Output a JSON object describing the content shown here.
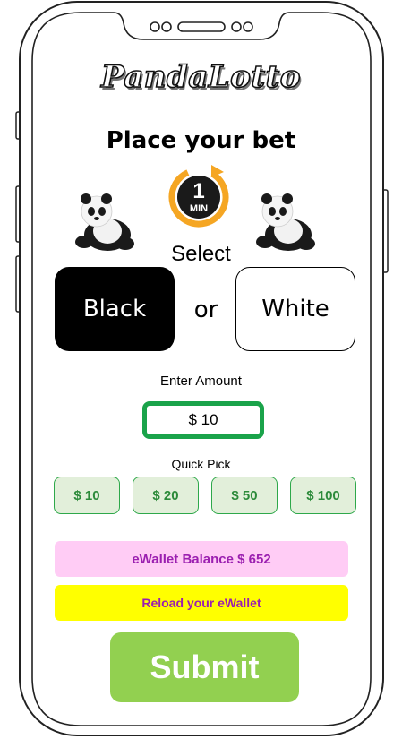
{
  "app": {
    "logo_text": "PandaLotto",
    "headline": "Place your bet"
  },
  "timer": {
    "value": "1",
    "unit": "MIN"
  },
  "bet": {
    "select_label": "Select",
    "black_label": "Black",
    "or_label": "or",
    "white_label": "White"
  },
  "amount": {
    "label": "Enter Amount",
    "value": "$ 10"
  },
  "quick_pick": {
    "label": "Quick Pick",
    "options": [
      "$ 10",
      "$ 20",
      "$ 50",
      "$ 100"
    ]
  },
  "wallet": {
    "balance_text": "eWallet Balance $ 652",
    "reload_label": "Reload your eWallet"
  },
  "submit_label": "Submit",
  "colors": {
    "timer_ring": "#f5a623",
    "amount_border": "#1aa34a",
    "quick_pick_bg": "#e2efda",
    "balance_bg": "#ffccf5",
    "reload_bg": "#ffff00",
    "submit_bg": "#92d050"
  }
}
